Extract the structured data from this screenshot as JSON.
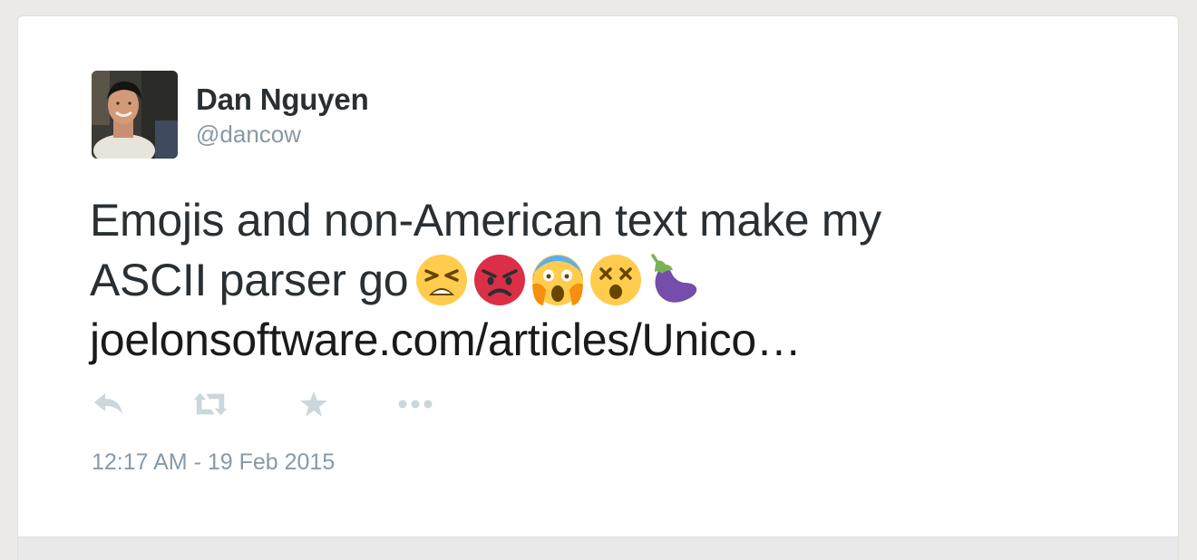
{
  "tweet": {
    "author": {
      "display_name": "Dan Nguyen",
      "handle": "@dancow"
    },
    "text_line1": "Emojis and non-American text make my",
    "text_line2": "ASCII parser go",
    "emojis": [
      "tired-face-emoji",
      "pouting-face-emoji",
      "screaming-face-emoji",
      "dizzy-face-emoji",
      "eggplant-emoji"
    ],
    "link": "joelonsoftware.com/articles/Unico…",
    "timestamp": "12:17 AM - 19 Feb 2015"
  },
  "actions": [
    {
      "name": "reply-icon"
    },
    {
      "name": "retweet-icon"
    },
    {
      "name": "favorite-icon"
    },
    {
      "name": "more-icon"
    }
  ],
  "colors": {
    "text": "#292f33",
    "muted": "#8899a6",
    "icon": "#ccd6dd",
    "background": "#ebeae7"
  }
}
